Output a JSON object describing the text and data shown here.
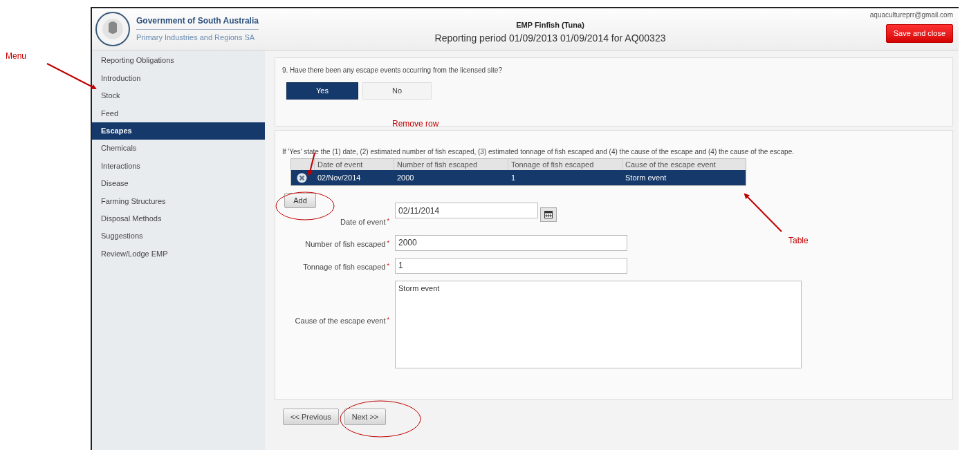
{
  "header": {
    "org": "Government of South Australia",
    "dept": "Primary Industries and Regions SA",
    "title": "EMP Finfish (Tuna)",
    "subtitle": "Reporting period 01/09/2013 01/09/2014 for AQ00323",
    "user": "aquacultureprr@gmail.com",
    "save_button": "Save and close"
  },
  "menu": [
    {
      "label": "Reporting Obligations",
      "selected": false
    },
    {
      "label": "Introduction",
      "selected": false
    },
    {
      "label": "Stock",
      "selected": false
    },
    {
      "label": "Feed",
      "selected": false
    },
    {
      "label": "Escapes",
      "selected": true
    },
    {
      "label": "Chemicals",
      "selected": false
    },
    {
      "label": "Interactions",
      "selected": false
    },
    {
      "label": "Disease",
      "selected": false
    },
    {
      "label": "Farming Structures",
      "selected": false
    },
    {
      "label": "Disposal Methods",
      "selected": false
    },
    {
      "label": "Suggestions",
      "selected": false
    },
    {
      "label": "Review/Lodge EMP",
      "selected": false
    }
  ],
  "question": {
    "text": "9. Have there been any escape events occurring from the licensed site?",
    "options": [
      {
        "label": "Yes",
        "selected": true
      },
      {
        "label": "No",
        "selected": false
      }
    ]
  },
  "instructions": "If 'Yes' state the (1) date, (2) estimated number of fish escaped, (3) estimated tonnage of fish escaped and (4) the cause of the escape and (4) the cause of the escape.",
  "table": {
    "columns": [
      "Date of event",
      "Number of fish escaped",
      "Tonnage of fish escaped",
      "Cause of the escape event"
    ],
    "rows": [
      {
        "selected": true,
        "cells": [
          "02/Nov/2014",
          "2000",
          "1",
          "Storm event"
        ]
      }
    ]
  },
  "add_button": "Add",
  "form": {
    "fields": [
      {
        "kind": "date",
        "label": "Date of event",
        "required_mark": "*",
        "value": "02/11/2014"
      },
      {
        "kind": "text",
        "label": "Number of fish escaped",
        "required_mark": "*",
        "value": "2000"
      },
      {
        "kind": "text",
        "label": "Tonnage of fish escaped",
        "required_mark": "*",
        "value": "1"
      },
      {
        "kind": "textarea",
        "label": "Cause of the escape event",
        "required_mark": "*",
        "value": "Storm event"
      }
    ]
  },
  "nav_buttons": [
    "<< Previous",
    "Next >>"
  ],
  "annotations": [
    "Menu",
    "Remove row",
    "Table"
  ]
}
